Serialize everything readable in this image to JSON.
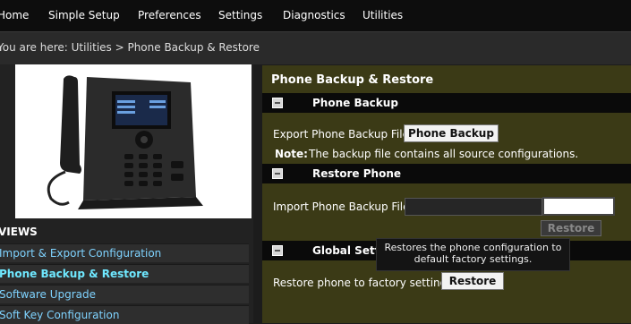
{
  "nav": {
    "items": [
      "Home",
      "Simple Setup",
      "Preferences",
      "Settings",
      "Diagnostics",
      "Utilities"
    ]
  },
  "breadcrumb": "You are here: Utilities > Phone Backup & Restore",
  "views": {
    "heading": "VIEWS",
    "items": [
      "Import & Export Configuration",
      "Phone Backup & Restore",
      "Software Upgrade",
      "Soft Key Configuration"
    ]
  },
  "main": {
    "title": "Phone Backup & Restore",
    "backup": {
      "header": "Phone Backup",
      "export_label": "Export Phone Backup File",
      "button": "Phone Backup",
      "note_label": "Note:",
      "note_text": "The backup file contains all source configurations."
    },
    "restore": {
      "header": "Restore Phone",
      "import_label": "Import Phone Backup File",
      "button": "Restore"
    },
    "global": {
      "header": "Global Settings",
      "factory_label": "Restore phone to factory settings",
      "button": "Restore",
      "tooltip": "Restores the phone configuration to default factory settings."
    }
  },
  "colors": {
    "panel": "#3b3a16",
    "link": "#7fd3ff",
    "section": "#0a0a0a"
  }
}
